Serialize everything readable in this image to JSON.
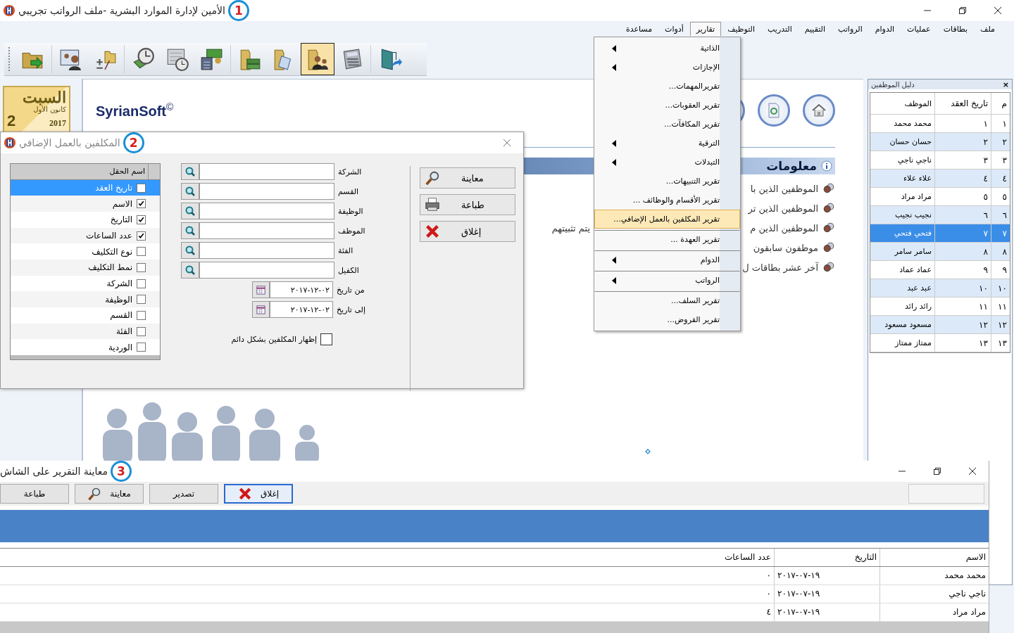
{
  "window": {
    "title": "الأمين لإدارة الموارد البشرية -ملف الرواتب تجريبي",
    "badge": "1"
  },
  "menu_bar": [
    {
      "label": "ملف",
      "selected": false
    },
    {
      "label": "بطاقات",
      "selected": false
    },
    {
      "label": "عمليات",
      "selected": false
    },
    {
      "label": "الدوام",
      "selected": false
    },
    {
      "label": "الرواتب",
      "selected": false
    },
    {
      "label": "التقييم",
      "selected": false
    },
    {
      "label": "التدريب",
      "selected": false
    },
    {
      "label": "التوظيف",
      "selected": false
    },
    {
      "label": "تقارير",
      "selected": true
    },
    {
      "label": "أدوات",
      "selected": false
    },
    {
      "label": "مساعدة",
      "selected": false
    }
  ],
  "toolbar": [
    {
      "selected": false
    },
    {
      "selected": false
    },
    {
      "selected": false
    },
    {
      "selected": false
    },
    {
      "selected": false
    },
    {
      "selected": false
    },
    {
      "selected": false
    },
    {
      "selected": false
    },
    {
      "selected": true
    },
    {
      "selected": false
    },
    {
      "selected": false
    }
  ],
  "date_card": {
    "day_name": "السبت",
    "month": "كانون الأول",
    "day": "2",
    "year": "2017"
  },
  "content": {
    "brand": "SyrianSoft",
    "brand_mark": "©",
    "info_title": "معلومات",
    "info_items": [
      {
        "text": "الموظفين الذين با"
      },
      {
        "text": "الموظفين الذين تر"
      },
      {
        "text": "الموظفين الذين م",
        "continuation": "يتم تثبيتهم"
      },
      {
        "text": "موظفون سابقون"
      },
      {
        "text": "آخر عشر بطاقات ل"
      }
    ]
  },
  "reports_menu": [
    {
      "label": "الذاتية",
      "kind": "submenu",
      "selected": false,
      "divider_above": false
    },
    {
      "label": "الإجازات",
      "kind": "submenu",
      "selected": false,
      "divider_above": false
    },
    {
      "label": "تقريرالمهمات...",
      "kind": "item",
      "selected": false,
      "divider_above": false
    },
    {
      "label": "تقرير العقوبات...",
      "kind": "item",
      "selected": false,
      "divider_above": false
    },
    {
      "label": "تقرير المكافآت...",
      "kind": "item",
      "selected": false,
      "divider_above": false
    },
    {
      "label": "الترقية",
      "kind": "submenu",
      "selected": false,
      "divider_above": false
    },
    {
      "label": "التبدلات",
      "kind": "submenu",
      "selected": false,
      "divider_above": false
    },
    {
      "label": "تقرير التنبيهات...",
      "kind": "item",
      "selected": false,
      "divider_above": false
    },
    {
      "label": "تقرير الأقسام والوظائف ...",
      "kind": "item",
      "selected": false,
      "divider_above": false
    },
    {
      "label": "تقرير المكلفين بالعمل الإضافي...",
      "kind": "item",
      "selected": true,
      "divider_above": false
    },
    {
      "label": "تقرير العهدة ...",
      "kind": "item",
      "selected": false,
      "divider_above": true
    },
    {
      "label": "الدوام",
      "kind": "submenu",
      "selected": false,
      "divider_above": true
    },
    {
      "label": "الرواتب",
      "kind": "submenu",
      "selected": false,
      "divider_above": true
    },
    {
      "label": "تقرير السلف...",
      "kind": "item",
      "selected": false,
      "divider_above": true
    },
    {
      "label": "تقرير القروض...",
      "kind": "item",
      "selected": false,
      "divider_above": false
    }
  ],
  "employee_panel": {
    "title": "دليل الموظفين",
    "close": "×",
    "columns": [
      "م",
      "تاريخ العقد",
      "الموظف"
    ],
    "rows": [
      {
        "no": "١",
        "contract": "١",
        "name": "محمد محمد",
        "selected": false
      },
      {
        "no": "٢",
        "contract": "٢",
        "name": "حسان حسان",
        "selected": false
      },
      {
        "no": "٣",
        "contract": "٣",
        "name": "ناجي ناجي",
        "selected": false
      },
      {
        "no": "٤",
        "contract": "٤",
        "name": "علاء علاء",
        "selected": false
      },
      {
        "no": "٥",
        "contract": "٥",
        "name": "مراد مراد",
        "selected": false
      },
      {
        "no": "٦",
        "contract": "٦",
        "name": "نجيب نجيب",
        "selected": false
      },
      {
        "no": "٧",
        "contract": "٧",
        "name": "فتحي فتحي",
        "selected": true
      },
      {
        "no": "٨",
        "contract": "٨",
        "name": "سامر سامر",
        "selected": false
      },
      {
        "no": "٩",
        "contract": "٩",
        "name": "عماد عماد",
        "selected": false
      },
      {
        "no": "١٠",
        "contract": "١٠",
        "name": "عبد عبد",
        "selected": false
      },
      {
        "no": "١١",
        "contract": "١١",
        "name": "رائد رائد",
        "selected": false
      },
      {
        "no": "١٢",
        "contract": "١٢",
        "name": "مسعود مسعود",
        "selected": false
      },
      {
        "no": "١٣",
        "contract": "١٣",
        "name": "ممتاز ممتاز",
        "selected": false
      }
    ]
  },
  "dialog": {
    "title": "المكلفين بالعمل الإضافي",
    "badge": "2",
    "buttons": [
      "معاينة",
      "طباعة",
      "إغلاق"
    ],
    "filters": [
      "الشركة",
      "القسم",
      "الوظيفة",
      "الموظف",
      "الفئة",
      "الكفيل"
    ],
    "dates": [
      {
        "label": "من تاريخ",
        "value": "٠٢-١٢-٢٠١٧"
      },
      {
        "label": "إلى تاريخ",
        "value": "٠٢-١٢-٢٠١٧"
      }
    ],
    "always_show": {
      "label": "إظهار المكلفين بشكل دائم",
      "checked": false
    },
    "fields": {
      "header": "اسم الحقل",
      "rows": [
        {
          "label": "تاريخ العقد",
          "checked": false,
          "selected": true
        },
        {
          "label": "الاسم",
          "checked": true,
          "selected": false
        },
        {
          "label": "التاريخ",
          "checked": true,
          "selected": false
        },
        {
          "label": "عدد الساعات",
          "checked": true,
          "selected": false
        },
        {
          "label": "نوع التكليف",
          "checked": false,
          "selected": false
        },
        {
          "label": "نمط التكليف",
          "checked": false,
          "selected": false
        },
        {
          "label": "الشركة",
          "checked": false,
          "selected": false
        },
        {
          "label": "الوظيفة",
          "checked": false,
          "selected": false
        },
        {
          "label": "القسم",
          "checked": false,
          "selected": false
        },
        {
          "label": "الفئة",
          "checked": false,
          "selected": false
        },
        {
          "label": "الوردية",
          "checked": false,
          "selected": false
        }
      ]
    }
  },
  "report": {
    "title": "معاينة التقرير على الشاش",
    "badge": "3",
    "buttons": [
      {
        "label": "إغلاق",
        "focused": true
      },
      {
        "label": "تصدير",
        "focused": false
      },
      {
        "label": "معاينة",
        "focused": false
      },
      {
        "label": "طباعة",
        "focused": false
      }
    ],
    "columns": [
      "الاسم",
      "التاريخ",
      "عدد الساعات"
    ],
    "rows": [
      [
        "محمد محمد",
        "١٩-٠٧-٢٠١٧",
        "٠"
      ],
      [
        "ناجي ناجي",
        "١٩-٠٧-٢٠١٧",
        "٠"
      ],
      [
        "مراد مراد",
        "١٩-٠٧-٢٠١٧",
        "٤"
      ]
    ]
  }
}
